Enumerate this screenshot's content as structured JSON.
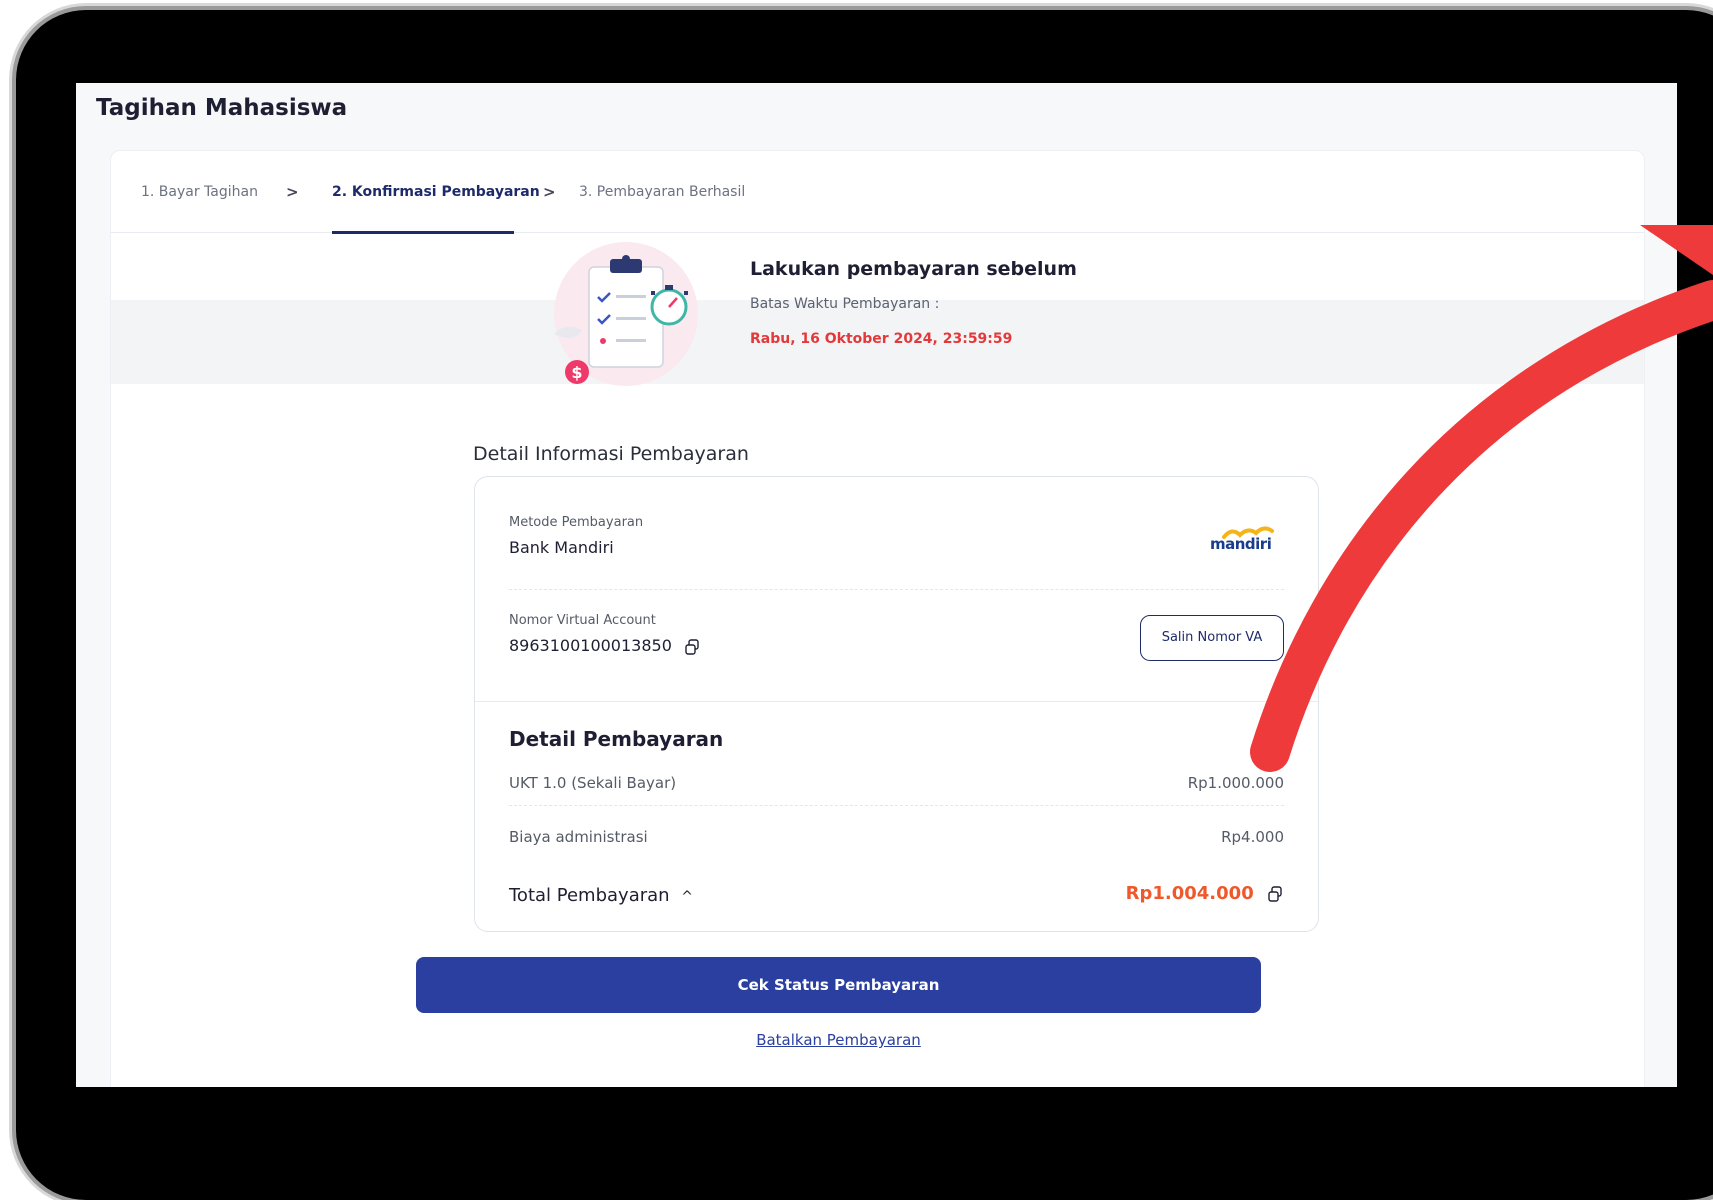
{
  "page": {
    "title": "Tagihan Mahasiswa"
  },
  "stepper": {
    "steps": [
      {
        "label": "1. Bayar Tagihan",
        "active": false
      },
      {
        "label": "2. Konfirmasi Pembayaran",
        "active": true
      },
      {
        "label": "3. Pembayaran Berhasil",
        "active": false
      }
    ],
    "separator": ">"
  },
  "deadline": {
    "title": "Lakukan pembayaran sebelum",
    "subtitle": "Batas Waktu Pembayaran :",
    "date": "Rabu, 16 Oktober 2024, 23:59:59"
  },
  "payment_info": {
    "section_title": "Detail Informasi Pembayaran",
    "method_label": "Metode Pembayaran",
    "method_value": "Bank Mandiri",
    "bank_logo_text": "mandiri",
    "va_label": "Nomor Virtual Account",
    "va_value": "8963100100013850",
    "copy_va_button": "Salin Nomor VA"
  },
  "payment_detail": {
    "title": "Detail Pembayaran",
    "items": [
      {
        "label": "UKT 1.0 (Sekali Bayar)",
        "value": "Rp1.000.000"
      },
      {
        "label": "Biaya administrasi",
        "value": "Rp4.000"
      }
    ],
    "total_label": "Total Pembayaran",
    "total_value": "Rp1.004.000"
  },
  "actions": {
    "check_status": "Cek Status Pembayaran",
    "cancel": "Batalkan Pembayaran"
  },
  "colors": {
    "primary": "#2a3f9f",
    "deadline_red": "#e23a3a",
    "total_orange": "#f0582b",
    "annotation_arrow": "#ee3a3a"
  }
}
